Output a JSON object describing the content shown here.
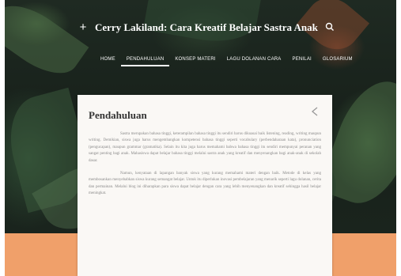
{
  "header": {
    "menu_icon": "plus-icon",
    "site_title": "Cerry Lakiland: Cara Kreatif Belajar Sastra Anak",
    "search_icon": "search-icon"
  },
  "nav": {
    "items": [
      {
        "label": "Home",
        "active": false
      },
      {
        "label": "Pendahuluan",
        "active": true
      },
      {
        "label": "Konsep Materi",
        "active": false
      },
      {
        "label": "Lagu Dolanan Cara",
        "active": false
      },
      {
        "label": "Penilai",
        "active": false
      },
      {
        "label": "Glosarium",
        "active": false
      }
    ]
  },
  "post": {
    "title": "Pendahuluan",
    "share_icon": "share-icon",
    "paragraphs": [
      "Sastra merupakan bahasa tinggi, keterampilan bahasa tinggi itu sendiri harus dikuasai baik listening, reading, writing maupun writing. Demikian, siswa juga harus mengembangkan kompetensi bahasa tinggi seperti vocabulary (perbendaharaan kata), pronunciation (pengucapan), maupun grammar (gramatika). Selain itu kita juga harus memahami bahwa bahasa tinggi itu sendiri mempunyai peranan yang sangat penting bagi anak. Mahasiswa dapat belajar bahasa tinggi melalui sastra anak yang kreatif dan menyenangkan bagi anak-anak di sekolah dasar.",
      "Namun, kenyataan di lapangan banyak siswa yang kurang memahami materi dengan baik. Metode di kelas yang membosankan menyebabkan siswa kurang semangat belajar. Untuk itu diperlukan inovasi pembelajaran yang menarik seperti lagu dolanan, cerita dan permainan. Melalui blog ini diharapkan para siswa dapat belajar dengan cara yang lebih menyenangkan dan kreatif sehingga hasil belajar meningkat."
    ]
  },
  "colors": {
    "hero_dark": "#1c261f",
    "band": "#f0a06a",
    "card": "#faf8f5",
    "title_text": "#333333",
    "body_text": "#8a8a8a"
  }
}
